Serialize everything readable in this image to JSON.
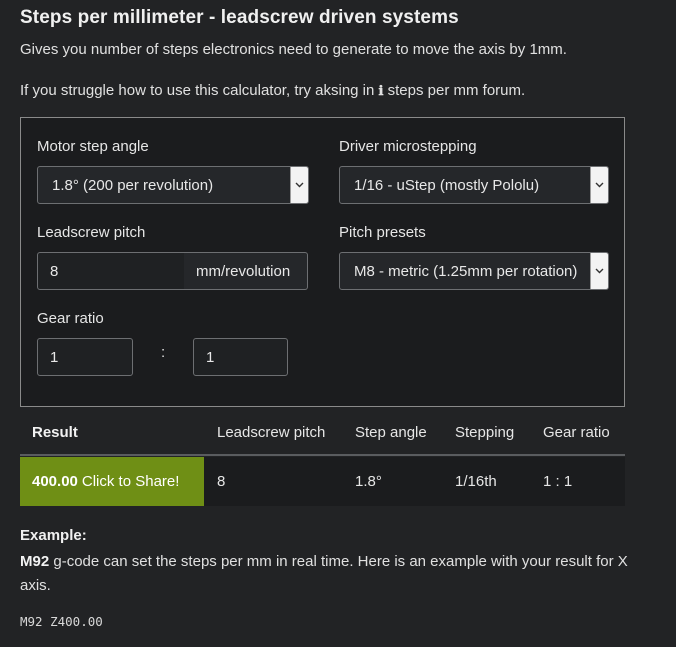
{
  "header": {
    "title": "Steps per millimeter - leadscrew driven systems",
    "subtitle": "Gives you number of steps electronics need to generate to move the axis by 1mm.",
    "help_prefix": "If you struggle how to use this calculator, try aksing in ",
    "help_link": "steps per mm forum",
    "help_suffix": "."
  },
  "form": {
    "motor_step_angle": {
      "label": "Motor step angle",
      "value": "1.8° (200 per revolution)"
    },
    "driver_microstepping": {
      "label": "Driver microstepping",
      "value": "1/16 - uStep (mostly Pololu)"
    },
    "leadscrew_pitch": {
      "label": "Leadscrew pitch",
      "value": "8",
      "unit": "mm/revolution"
    },
    "pitch_presets": {
      "label": "Pitch presets",
      "value": "M8 - metric (1.25mm per rotation)"
    },
    "gear_ratio": {
      "label": "Gear ratio",
      "left": "1",
      "separator": ":",
      "right": "1"
    }
  },
  "results": {
    "headers": [
      "Result",
      "Leadscrew pitch",
      "Step angle",
      "Stepping",
      "Gear ratio"
    ],
    "row": {
      "result": "400.00",
      "share_label": "Click to Share!",
      "leadscrew_pitch": "8",
      "step_angle": "1.8°",
      "stepping": "1/16th",
      "gear_ratio": "1 : 1"
    }
  },
  "example": {
    "heading": "Example:",
    "gcode_name": "M92",
    "text": " g-code can set the steps per mm in real time. Here is an example with your result for X axis.",
    "code": "M92 Z400.00"
  },
  "colors": {
    "background": "#222325",
    "panel": "#1b1c1e",
    "share_green": "#6f8f15"
  }
}
